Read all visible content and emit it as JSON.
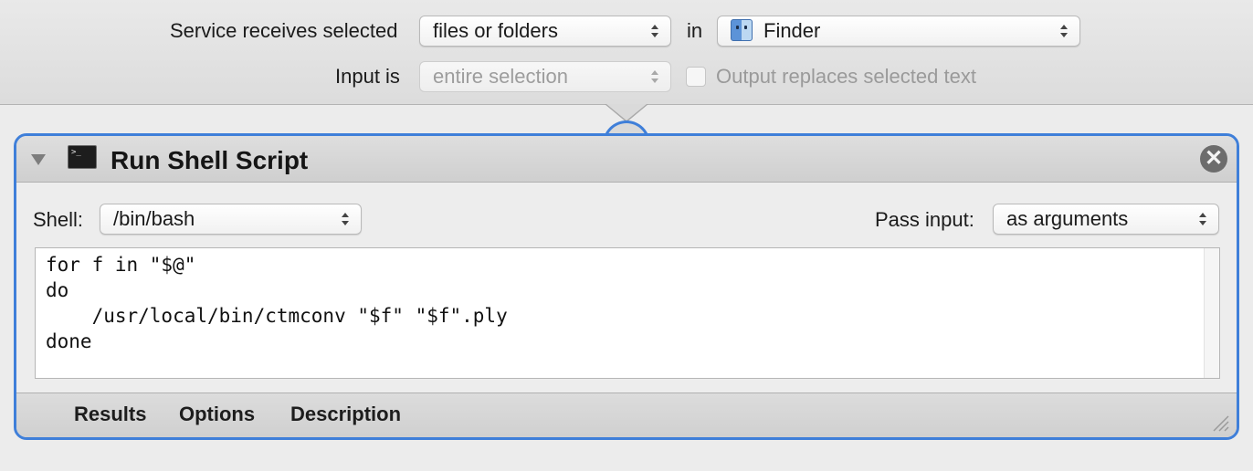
{
  "service": {
    "receives_label": "Service receives selected",
    "receives_value": "files or folders",
    "in_label": "in",
    "app_value": "Finder",
    "app_icon": "finder-icon",
    "input_label": "Input is",
    "input_value": "entire selection",
    "output_replaces_label": "Output replaces selected text",
    "output_replaces_checked": false
  },
  "action": {
    "title": "Run Shell Script",
    "icon": "terminal-icon",
    "close_glyph": "✕",
    "shell_label": "Shell:",
    "shell_value": "/bin/bash",
    "pass_input_label": "Pass input:",
    "pass_input_value": "as arguments",
    "script": "for f in \"$@\"\ndo\n    /usr/local/bin/ctmconv \"$f\" \"$f\".ply\ndone",
    "footer_tabs": [
      "Results",
      "Options",
      "Description"
    ]
  },
  "colors": {
    "accent": "#3f7fd9",
    "background": "#ececec"
  }
}
